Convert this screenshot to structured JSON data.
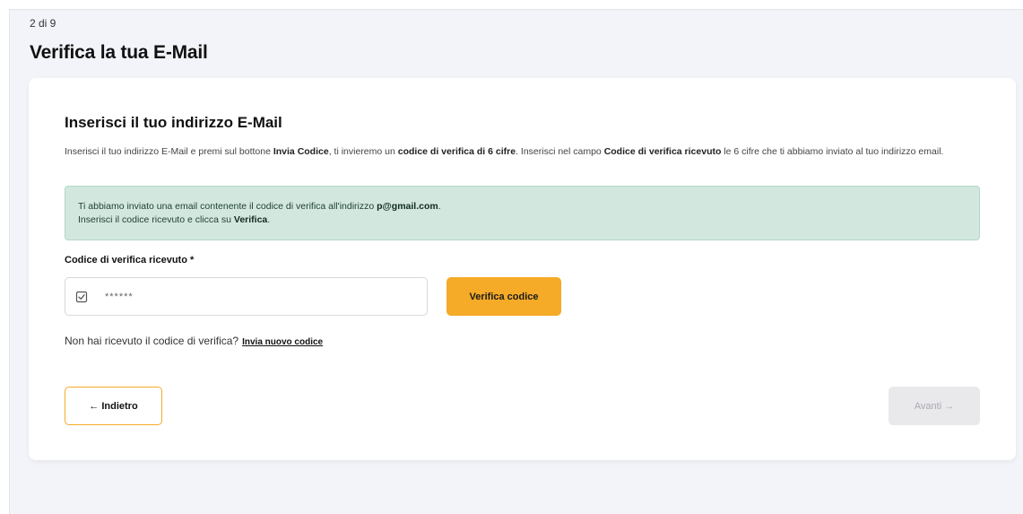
{
  "header": {
    "step": "2 di 9",
    "title": "Verifica la tua E-Mail"
  },
  "card": {
    "title": "Inserisci il tuo indirizzo E-Mail",
    "description": {
      "part1": "Inserisci il tuo indirizzo E-Mail e premi sul bottone ",
      "bold1": "Invia Codice",
      "part2": ", ti invieremo un ",
      "bold2": "codice di verifica di 6 cifre",
      "part3": ". Inserisci nel campo ",
      "bold3": "Codice di verifica ricevuto",
      "part4": " le 6 cifre che ti abbiamo inviato al tuo indirizzo email."
    },
    "alert": {
      "line1_text": "Ti abbiamo inviato una email contenente il codice di verifica all'indirizzo ",
      "line1_email": "p@gmail.com",
      "line1_end": ".",
      "line2_text": "Inserisci il codice ricevuto e clicca su ",
      "line2_bold": "Verifica",
      "line2_end": "."
    },
    "code_field": {
      "label": "Codice di verifica ricevuto *",
      "placeholder": "******",
      "value": ""
    },
    "verify_button": "Verifica codice",
    "resend": {
      "text": "Non hai ricevuto il codice di verifica?",
      "link": "Invia nuovo codice"
    },
    "back_button": "← Indietro",
    "next_button": "Avanti →"
  },
  "colors": {
    "accent": "#f5aa28",
    "alert_bg": "#d2e8df",
    "disabled_bg": "#e9e9ec"
  },
  "icons": {
    "input_icon": "checkbox-icon"
  }
}
